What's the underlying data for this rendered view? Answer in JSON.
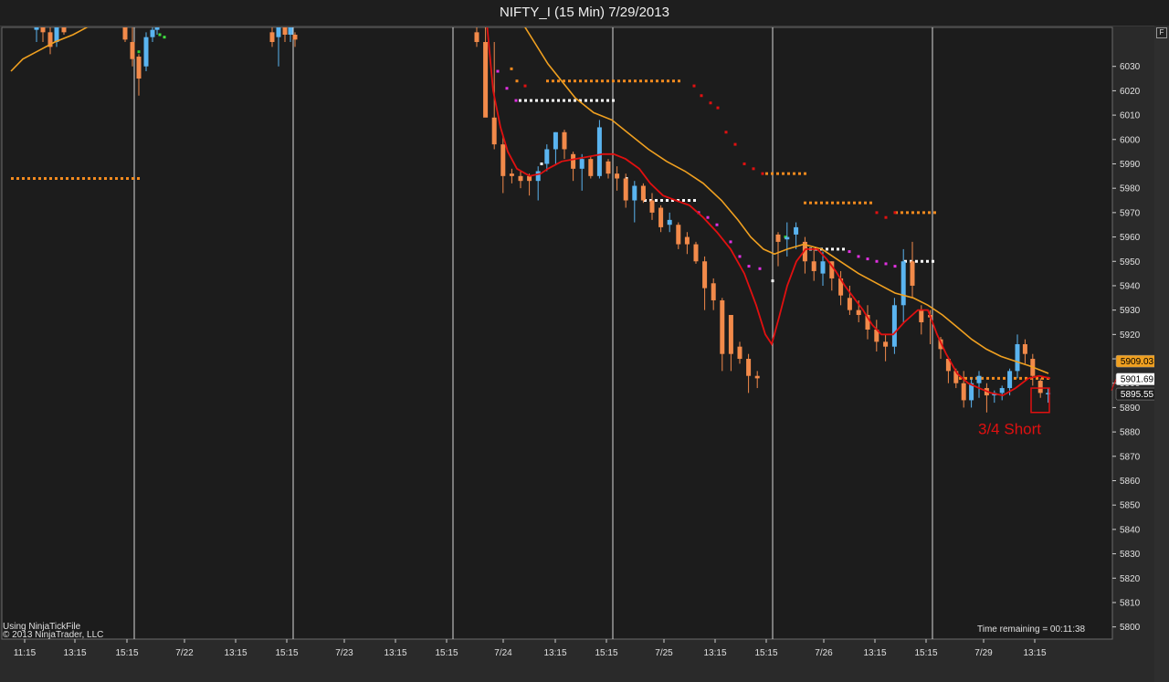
{
  "window": {
    "title": "NIFTY_I (15 Min)  7/29/2013"
  },
  "footer": {
    "source_line1": "Using NinjaTickFile",
    "source_line2": "© 2013 NinjaTrader, LLC",
    "time_remaining": "Time remaining = 00:11:38",
    "f_button": "F"
  },
  "annotation": {
    "text": "3/4 Short",
    "color": "#e01010"
  },
  "colors": {
    "background": "#1c1c1c",
    "up": "#5ab4f0",
    "down": "#f28a4a",
    "ema_fast": "#e01010",
    "ema_slow": "#f0a020"
  },
  "chart_data": {
    "type": "candlestick",
    "ylim": [
      5795,
      6046
    ],
    "y_ticks": [
      6030,
      6020,
      6010,
      6000,
      5990,
      5980,
      5970,
      5960,
      5950,
      5940,
      5930,
      5920,
      5910,
      5900,
      5890,
      5880,
      5870,
      5860,
      5850,
      5840,
      5830,
      5820,
      5810,
      5800
    ],
    "x_tick_labels": [
      "11:15",
      "13:15",
      "15:15",
      "7/22",
      "13:15",
      "15:15",
      "7/23",
      "13:15",
      "15:15",
      "7/24",
      "13:15",
      "15:15",
      "7/25",
      "13:15",
      "15:15",
      "7/26",
      "13:15",
      "15:15",
      "7/29",
      "13:15"
    ],
    "session_breaks": [
      "7/22",
      "7/23",
      "7/24",
      "7/25",
      "7/26",
      "7/29"
    ],
    "price_labels": [
      {
        "text": "5909.03",
        "value": 5909.03,
        "bg": "#f0a020",
        "fg": "#000000"
      },
      {
        "text": "5901.69",
        "value": 5901.69,
        "bg": "#ffffff",
        "fg": "#000000"
      },
      {
        "text": "5895.55",
        "value": 5895.55,
        "bg": "#1c1c1c",
        "fg": "#ffffff"
      }
    ],
    "candles": [
      [
        6048,
        6045,
        6040,
        6047
      ],
      [
        6048,
        6046,
        6040,
        6044
      ],
      [
        6046,
        6044,
        6035,
        6038
      ],
      [
        6047,
        6040,
        6038,
        6046
      ],
      [
        6049,
        6048,
        6043,
        6044
      ],
      [
        6050,
        6047,
        6046,
        6049
      ],
      [
        6049,
        6048,
        6040,
        6041
      ],
      [
        6048,
        6040,
        6030,
        6033
      ],
      [
        6035,
        6034,
        6018,
        6025
      ],
      [
        6044,
        6030,
        6028,
        6042
      ],
      [
        6047,
        6042,
        6040,
        6045
      ],
      [
        6048,
        6045,
        6043,
        6046
      ],
      [
        6048,
        6044,
        6038,
        6040
      ],
      [
        6049,
        6042,
        6030,
        6047
      ],
      [
        6047,
        6046,
        6040,
        6043
      ],
      [
        6048,
        6043,
        6040,
        6046
      ],
      [
        6044,
        6043,
        6038,
        6041
      ],
      [
        6047,
        6044,
        6038,
        6040
      ],
      [
        6048,
        6040,
        6020,
        6009
      ],
      [
        6040,
        6009,
        5996,
        5998
      ],
      [
        6002,
        5998,
        5978,
        5985
      ],
      [
        5988,
        5986,
        5982,
        5985
      ],
      [
        5987,
        5985,
        5980,
        5983
      ],
      [
        5986,
        5985,
        5977,
        5983
      ],
      [
        5989,
        5983,
        5975,
        5987
      ],
      [
        5998,
        5990,
        5987,
        5996
      ],
      [
        6003,
        5996,
        5990,
        6003
      ],
      [
        6004,
        6003,
        5992,
        5996
      ],
      [
        5995,
        5994,
        5983,
        5988
      ],
      [
        5994,
        5988,
        5979,
        5992
      ],
      [
        5993,
        5992,
        5984,
        5985
      ],
      [
        6008,
        5985,
        5984,
        6005
      ],
      [
        5992,
        5991,
        5984,
        5986
      ],
      [
        5989,
        5986,
        5979,
        5984
      ],
      [
        5986,
        5984,
        5972,
        5975
      ],
      [
        5983,
        5975,
        5966,
        5981
      ],
      [
        5982,
        5981,
        5974,
        5975
      ],
      [
        5978,
        5975,
        5967,
        5970
      ],
      [
        5973,
        5972,
        5962,
        5964
      ],
      [
        5970,
        5965,
        5962,
        5967
      ],
      [
        5966,
        5965,
        5955,
        5957
      ],
      [
        5962,
        5960,
        5953,
        5957
      ],
      [
        5958,
        5957,
        5949,
        5950
      ],
      [
        5952,
        5950,
        5930,
        5939
      ],
      [
        5943,
        5941,
        5930,
        5934
      ],
      [
        5935,
        5934,
        5905,
        5912
      ],
      [
        5925,
        5928,
        5905,
        5912
      ],
      [
        5917,
        5915,
        5908,
        5910
      ],
      [
        5912,
        5910,
        5896,
        5903
      ],
      [
        5905,
        5903,
        5898,
        5902
      ],
      [
        5962,
        5961,
        5948,
        5958
      ],
      [
        5966,
        5959,
        5952,
        5960
      ],
      [
        5966,
        5961,
        5955,
        5964
      ],
      [
        5960,
        5958,
        5945,
        5950
      ],
      [
        5955,
        5950,
        5942,
        5946
      ],
      [
        5954,
        5945,
        5940,
        5950
      ],
      [
        5950,
        5950,
        5938,
        5943
      ],
      [
        5946,
        5943,
        5932,
        5936
      ],
      [
        5940,
        5935,
        5928,
        5930
      ],
      [
        5934,
        5930,
        5925,
        5928
      ],
      [
        5932,
        5928,
        5918,
        5922
      ],
      [
        5926,
        5922,
        5913,
        5917
      ],
      [
        5920,
        5917,
        5909,
        5915
      ],
      [
        5935,
        5915,
        5912,
        5932
      ],
      [
        5955,
        5932,
        5925,
        5950
      ],
      [
        5958,
        5950,
        5935,
        5940
      ],
      [
        5932,
        5930,
        5920,
        5925
      ],
      [
        5930,
        5928,
        5916,
        5927
      ],
      [
        5919,
        5918,
        5910,
        5914
      ],
      [
        5910,
        5910,
        5900,
        5905
      ],
      [
        5906,
        5905,
        5898,
        5900
      ],
      [
        5905,
        5900,
        5890,
        5893
      ],
      [
        5902,
        5893,
        5890,
        5900
      ],
      [
        5905,
        5900,
        5894,
        5903
      ],
      [
        5900,
        5898,
        5888,
        5895
      ],
      [
        5897,
        5895,
        5892,
        5896
      ],
      [
        5899,
        5896,
        5893,
        5898
      ],
      [
        5906,
        5898,
        5895,
        5905
      ],
      [
        5920,
        5905,
        5902,
        5916
      ],
      [
        5918,
        5916,
        5908,
        5912
      ],
      [
        5912,
        5910,
        5899,
        5903
      ],
      [
        5902,
        5901,
        5894,
        5896
      ],
      [
        5898,
        5896,
        5892,
        5896
      ]
    ],
    "ema_fast": [
      [
        533,
        6048
      ],
      [
        540,
        6020
      ],
      [
        548,
        6005
      ],
      [
        556,
        5995
      ],
      [
        566,
        5988
      ],
      [
        580,
        5985
      ],
      [
        592,
        5986
      ],
      [
        600,
        5988
      ],
      [
        615,
        5991
      ],
      [
        630,
        5992
      ],
      [
        645,
        5993
      ],
      [
        660,
        5994
      ],
      [
        672,
        5994
      ],
      [
        685,
        5992
      ],
      [
        700,
        5988
      ],
      [
        712,
        5982
      ],
      [
        726,
        5977
      ],
      [
        740,
        5975
      ],
      [
        755,
        5973
      ],
      [
        770,
        5968
      ],
      [
        785,
        5962
      ],
      [
        800,
        5955
      ],
      [
        815,
        5945
      ],
      [
        828,
        5932
      ],
      [
        838,
        5920
      ],
      [
        845,
        5916
      ],
      [
        853,
        5927
      ],
      [
        862,
        5940
      ],
      [
        872,
        5950
      ],
      [
        882,
        5955
      ],
      [
        895,
        5955
      ],
      [
        905,
        5951
      ],
      [
        915,
        5946
      ],
      [
        925,
        5940
      ],
      [
        935,
        5935
      ],
      [
        945,
        5930
      ],
      [
        955,
        5924
      ],
      [
        965,
        5920
      ],
      [
        978,
        5920
      ],
      [
        990,
        5925
      ],
      [
        1005,
        5930
      ],
      [
        1016,
        5930
      ],
      [
        1026,
        5920
      ],
      [
        1036,
        5912
      ],
      [
        1048,
        5904
      ],
      [
        1060,
        5900
      ],
      [
        1072,
        5898
      ],
      [
        1085,
        5896
      ],
      [
        1098,
        5895
      ],
      [
        1112,
        5898
      ],
      [
        1126,
        5902
      ],
      [
        1138,
        5903
      ],
      [
        1150,
        5902
      ]
    ],
    "ema_slow": [
      [
        12,
        6028
      ],
      [
        25,
        6033
      ],
      [
        40,
        6036
      ],
      [
        60,
        6040
      ],
      [
        80,
        6043
      ],
      [
        95,
        6046
      ],
      [
        107,
        6049
      ],
      [
        570,
        6049
      ],
      [
        585,
        6040
      ],
      [
        600,
        6031
      ],
      [
        615,
        6024
      ],
      [
        630,
        6017
      ],
      [
        650,
        6011
      ],
      [
        670,
        6008
      ],
      [
        690,
        6002
      ],
      [
        710,
        5996
      ],
      [
        730,
        5991
      ],
      [
        750,
        5987
      ],
      [
        770,
        5982
      ],
      [
        790,
        5975
      ],
      [
        808,
        5967
      ],
      [
        822,
        5960
      ],
      [
        836,
        5955
      ],
      [
        848,
        5953
      ],
      [
        862,
        5955
      ],
      [
        880,
        5957
      ],
      [
        900,
        5955
      ],
      [
        920,
        5950
      ],
      [
        940,
        5945
      ],
      [
        960,
        5941
      ],
      [
        980,
        5937
      ],
      [
        1000,
        5935
      ],
      [
        1016,
        5932
      ],
      [
        1032,
        5928
      ],
      [
        1048,
        5923
      ],
      [
        1064,
        5918
      ],
      [
        1080,
        5914
      ],
      [
        1096,
        5911
      ],
      [
        1112,
        5909
      ],
      [
        1128,
        5907
      ],
      [
        1148,
        5904
      ]
    ],
    "dot_lines": [
      {
        "color": "#f28a1e",
        "y": 5984,
        "x1": 12,
        "x2": 150
      },
      {
        "color": "#f28a1e",
        "y": 6024,
        "x1": 598,
        "x2": 745
      },
      {
        "color": "#ffffff",
        "y": 6016,
        "x1": 568,
        "x2": 675
      },
      {
        "color": "#ffffff",
        "y": 5975,
        "x1": 705,
        "x2": 760
      },
      {
        "color": "#f28a1e",
        "y": 5986,
        "x1": 838,
        "x2": 880
      },
      {
        "color": "#f28a1e",
        "y": 5974,
        "x1": 880,
        "x2": 955
      },
      {
        "color": "#f28a1e",
        "y": 5970,
        "x1": 980,
        "x2": 1025
      },
      {
        "color": "#ffffff",
        "y": 5955,
        "x1": 880,
        "x2": 925
      },
      {
        "color": "#ffffff",
        "y": 5950,
        "x1": 990,
        "x2": 1025
      },
      {
        "color": "#f28a1e",
        "y": 5902,
        "x1": 1050,
        "x2": 1150
      }
    ],
    "dot_points": [
      [
        "#f28a1e",
        560,
        6029
      ],
      [
        "#f28a1e",
        566,
        6024
      ],
      [
        "#e01010",
        575,
        6022
      ],
      [
        "#e01010",
        760,
        6022
      ],
      [
        "#e01010",
        768,
        6018
      ],
      [
        "#e01010",
        778,
        6015
      ],
      [
        "#e01010",
        786,
        6013
      ],
      [
        "#e01010",
        795,
        6003
      ],
      [
        "#e01010",
        805,
        5998
      ],
      [
        "#e01010",
        815,
        5990
      ],
      [
        "#e01010",
        825,
        5988
      ],
      [
        "#e01010",
        835,
        5986
      ],
      [
        "#e01010",
        960,
        5970
      ],
      [
        "#e01010",
        970,
        5968
      ],
      [
        "#e01010",
        980,
        5970
      ],
      [
        "#e030e0",
        545,
        6028
      ],
      [
        "#e030e0",
        555,
        6021
      ],
      [
        "#e030e0",
        565,
        6016
      ],
      [
        "#e030e0",
        765,
        5970
      ],
      [
        "#e030e0",
        775,
        5968
      ],
      [
        "#e030e0",
        785,
        5965
      ],
      [
        "#e030e0",
        800,
        5958
      ],
      [
        "#e030e0",
        810,
        5952
      ],
      [
        "#e030e0",
        820,
        5948
      ],
      [
        "#e030e0",
        832,
        5947
      ],
      [
        "#e030e0",
        930,
        5954
      ],
      [
        "#e030e0",
        940,
        5952
      ],
      [
        "#e030e0",
        950,
        5951
      ],
      [
        "#e030e0",
        960,
        5950
      ],
      [
        "#e030e0",
        970,
        5949
      ],
      [
        "#e030e0",
        980,
        5948
      ],
      [
        "#40e040",
        175,
        6043
      ],
      [
        "#40e040",
        180,
        6042
      ],
      [
        "#30d030",
        152,
        6036
      ],
      [
        "#30d030",
        860,
        5960
      ],
      [
        "#ffffff",
        593,
        5990
      ],
      [
        "#ffffff",
        686,
        5984
      ],
      [
        "#ffffff",
        846,
        5942
      ]
    ],
    "candle_x_positions": {
      "start_a": [
        20,
        9
      ],
      "start_b": [
        538,
        8.2
      ],
      "start_c": [
        852,
        8.2
      ],
      "start_d": [
        1030,
        8.2
      ]
    }
  }
}
